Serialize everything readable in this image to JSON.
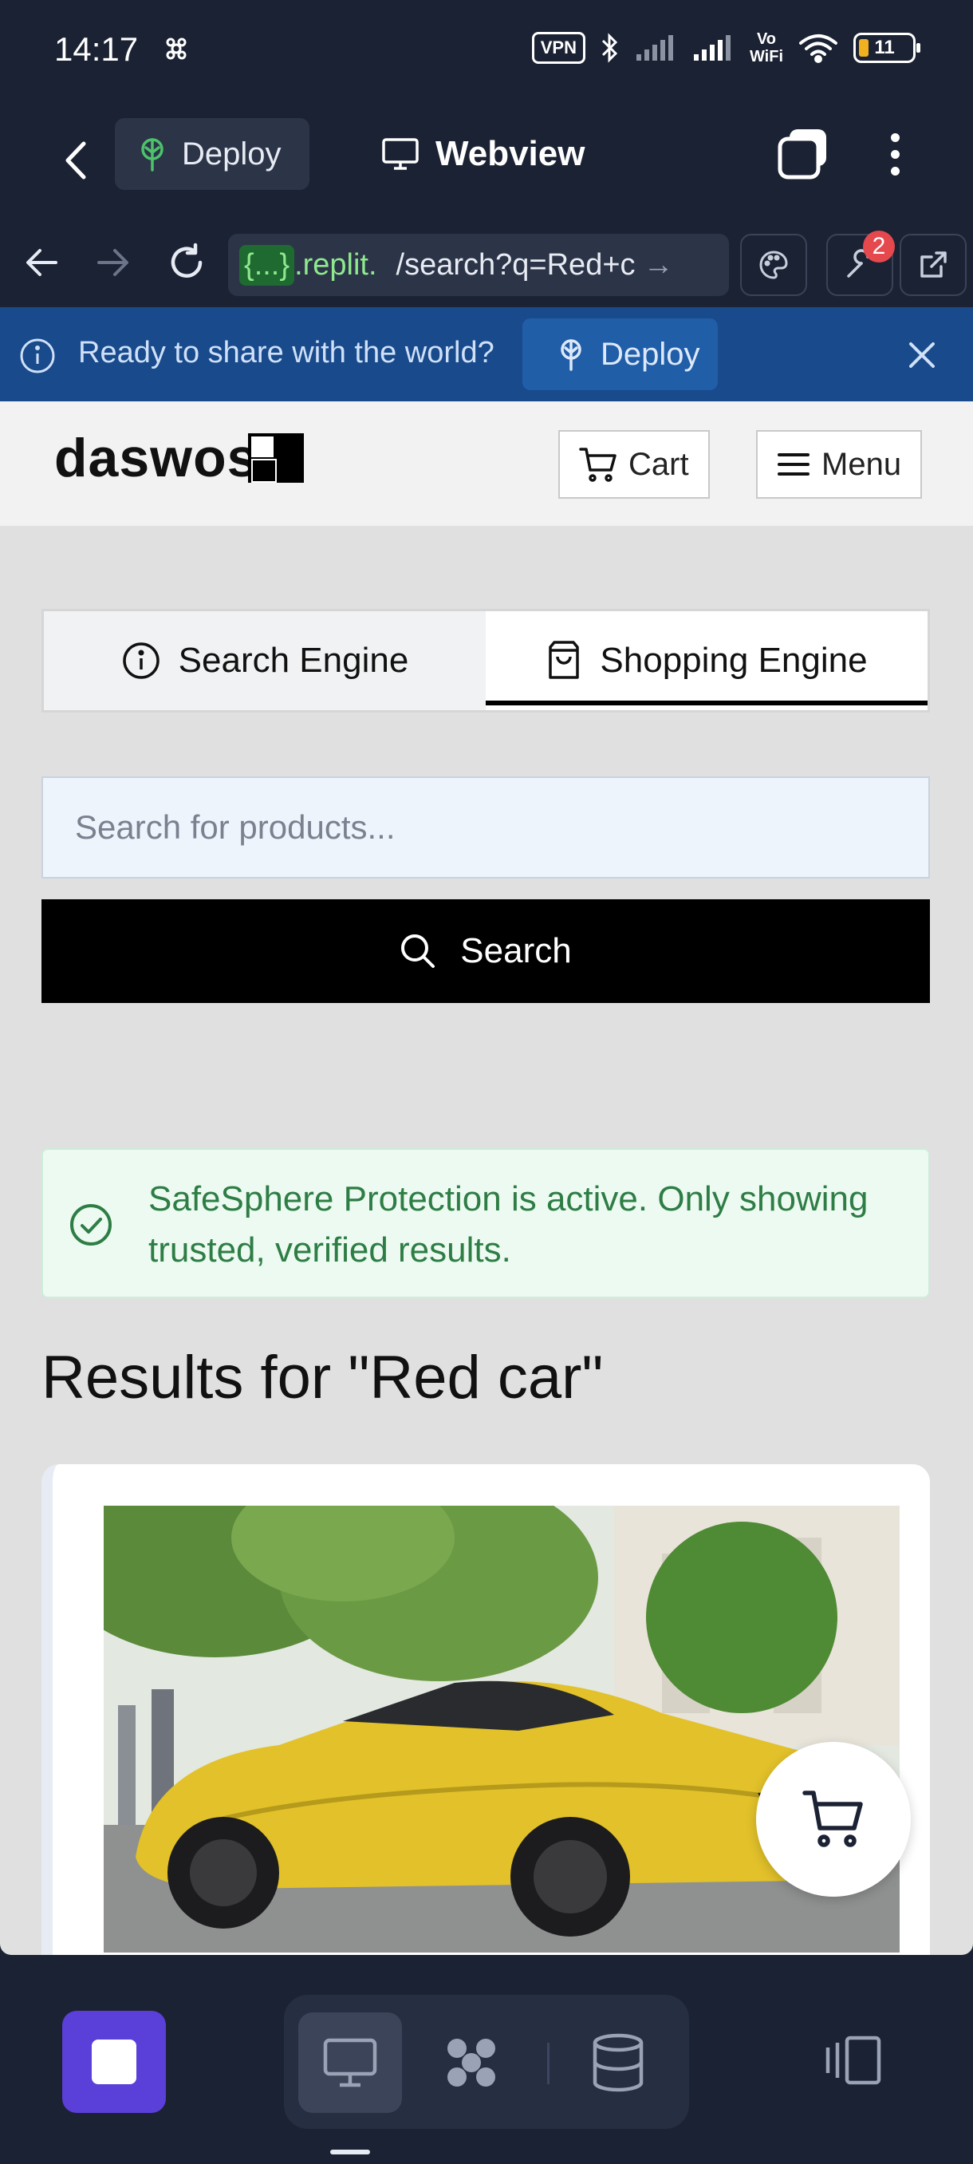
{
  "status_bar": {
    "time": "14:17",
    "vpn": "VPN",
    "vowifi_top": "Vo",
    "vowifi_bottom": "WiFi",
    "battery": "11"
  },
  "app_header": {
    "deploy_label": "Deploy",
    "webview_label": "Webview"
  },
  "url_bar": {
    "host_badge": "{...}",
    "domain": ".replit.",
    "path": "/search?q=Red+c",
    "arrow": "→",
    "devtools_badge": "2"
  },
  "banner": {
    "text": "Ready to share with the world?",
    "deploy_label": "Deploy"
  },
  "site": {
    "logo_text": "daswos",
    "cart_label": "Cart",
    "menu_label": "Menu",
    "tabs": [
      {
        "label": "Search Engine",
        "active": false
      },
      {
        "label": "Shopping Engine",
        "active": true
      }
    ],
    "search": {
      "placeholder": "Search for products...",
      "button_label": "Search"
    },
    "alert_text": "SafeSphere Protection is active. Only showing trusted, verified results.",
    "results_title": "Results for \"Red car\""
  },
  "colors": {
    "chrome_bg": "#1b2233",
    "banner_bg": "#184a8c",
    "accent_purple": "#5a3fd9",
    "success_green": "#2e7d45",
    "badge_red": "#e5484d"
  },
  "icons": [
    "back-icon",
    "deploy-icon",
    "monitor-icon",
    "tabs-icon",
    "more-icon",
    "forward-icon",
    "reload-icon",
    "palette-icon",
    "wrench-icon",
    "external-link-icon",
    "info-icon",
    "close-icon",
    "cart-icon",
    "menu-icon",
    "shopping-bag-icon",
    "search-icon",
    "check-circle-icon",
    "stop-icon",
    "agent-icon",
    "database-icon",
    "layout-icon"
  ]
}
